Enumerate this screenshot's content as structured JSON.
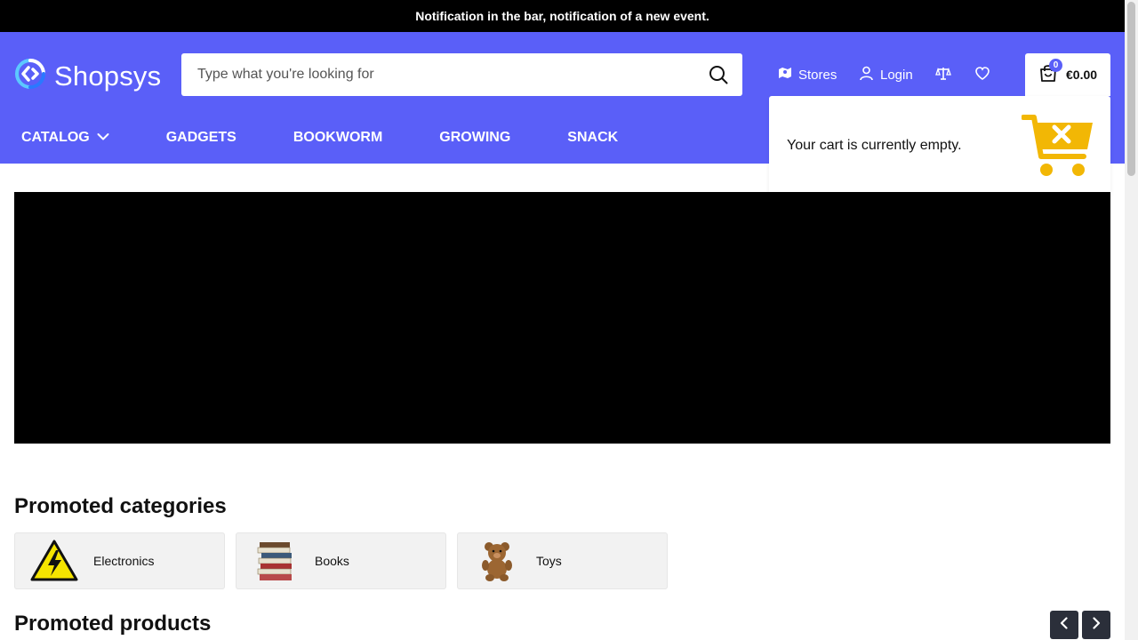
{
  "notification": {
    "text": "Notification in the bar, notification of a new event."
  },
  "logo": {
    "text": "Shopsys"
  },
  "search": {
    "placeholder": "Type what you're looking for"
  },
  "header_links": {
    "stores": "Stores",
    "login": "Login"
  },
  "cart": {
    "count": "0",
    "price": "€0.00",
    "empty_message": "Your cart is currently empty."
  },
  "nav": {
    "items": [
      "CATALOG",
      "GADGETS",
      "BOOKWORM",
      "GROWING",
      "SNACK"
    ]
  },
  "promoted_categories": {
    "title": "Promoted categories",
    "items": [
      {
        "label": "Electronics"
      },
      {
        "label": "Books"
      },
      {
        "label": "Toys"
      }
    ]
  },
  "promoted_products": {
    "title": "Promoted products"
  },
  "colors": {
    "brand": "#5a5ff8",
    "notification_bg": "#000000",
    "cart_icon": "#f2b705",
    "arrow_button": "#2b2f3a"
  }
}
